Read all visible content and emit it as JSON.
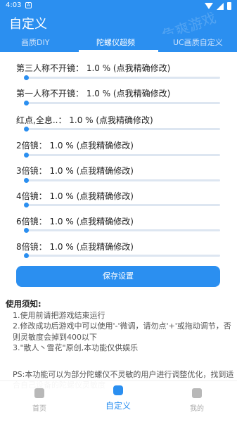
{
  "status_bar": {
    "time": "4:03",
    "notification_badge": "A"
  },
  "app_bar": {
    "title": "自定义",
    "watermark": "危爽游戏"
  },
  "tabs": [
    {
      "label": "画质DIY",
      "active": false
    },
    {
      "label": "陀螺仪超频",
      "active": true
    },
    {
      "label": "UC画质自定义",
      "active": false
    }
  ],
  "sliders": [
    {
      "label": "第三人称不开镜：  1.0 %  (点我精确修改)",
      "value_percent": 1.0
    },
    {
      "label": "第一人称不开镜：  1.0 %  (点我精确修改)",
      "value_percent": 1.0
    },
    {
      "label": "红点,全息..：  1.0 %  (点我精确修改)",
      "value_percent": 1.0
    },
    {
      "label": "2倍镜：  1.0 %  (点我精确修改)",
      "value_percent": 1.0
    },
    {
      "label": "3倍镜：  1.0 %  (点我精确修改)",
      "value_percent": 1.0
    },
    {
      "label": "4倍镜：  1.0 %  (点我精确修改)",
      "value_percent": 1.0
    },
    {
      "label": "6倍镜：  1.0 %  (点我精确修改)",
      "value_percent": 1.0
    },
    {
      "label": "8倍镜：  1.0 %  (点我精确修改)",
      "value_percent": 1.0
    }
  ],
  "save_button": "保存设置",
  "notes": {
    "heading": "使用须知:",
    "lines": [
      "1.使用前请把游戏结束运行",
      "2.修改成功后游戏中可以使用'-'微调，请勿点'+'或拖动调节，否则灵敏度会掉到400以下",
      "3.\"散人丶雪花\"原创,本功能仅供娱乐"
    ],
    "ps": "PS:本功能可以为部分陀螺仪不灵敏的用户进行调整优化，找到适合自己设备的陀螺仪灵敏度"
  },
  "bottom_nav": [
    {
      "label": "首页",
      "icon": "home-icon",
      "active": false
    },
    {
      "label": "自定义",
      "icon": "customize-icon",
      "active": true
    },
    {
      "label": "我的",
      "icon": "profile-icon",
      "active": false
    }
  ],
  "colors": {
    "primary": "#2b8ff0",
    "track": "#dde6f1"
  }
}
